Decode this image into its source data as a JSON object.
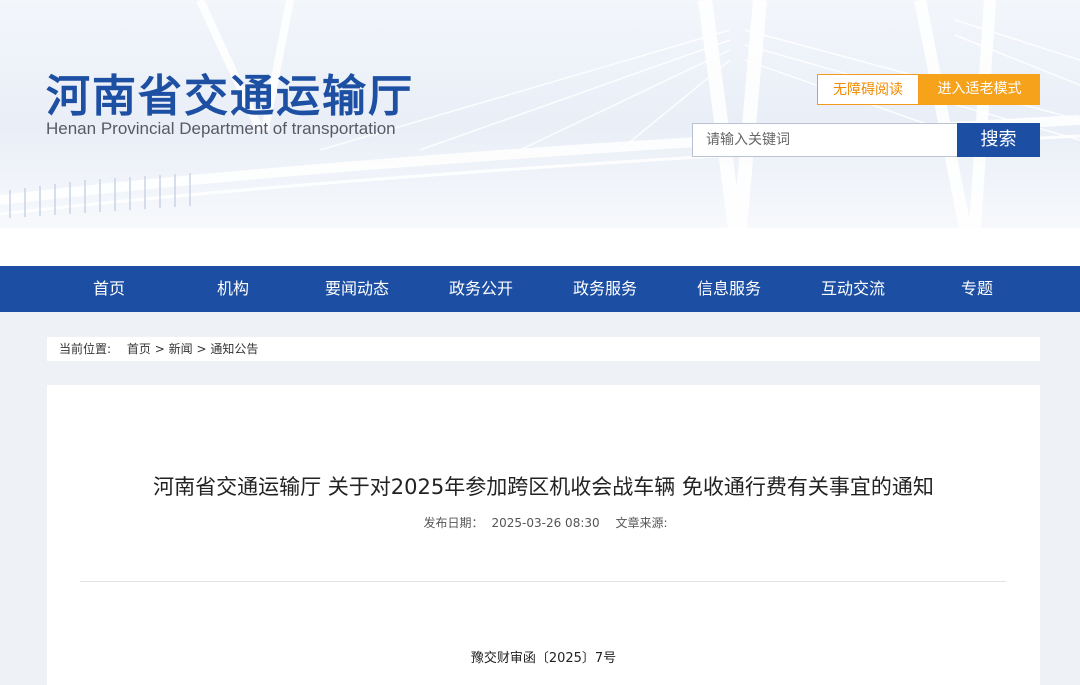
{
  "header": {
    "title_cn": "河南省交通运输厅",
    "title_en": "Henan Provincial Department of transportation",
    "accessibility_label": "无障碍阅读",
    "elder_mode_label": "进入适老模式",
    "search_placeholder": "请输入关键词",
    "search_button": "搜索"
  },
  "nav": {
    "items": [
      "首页",
      "机构",
      "要闻动态",
      "政务公开",
      "政务服务",
      "信息服务",
      "互动交流",
      "专题"
    ]
  },
  "breadcrumb": {
    "label": "当前位置:",
    "items": [
      "首页",
      "新闻",
      "通知公告"
    ],
    "separator": ">"
  },
  "article": {
    "title": "河南省交通运输厅 关于对2025年参加跨区机收会战车辆 免收通行费有关事宜的通知",
    "publish_label": "发布日期：",
    "publish_date": "2025-03-26 08:30",
    "source_label": "文章来源:",
    "doc_number": "豫交财审函〔2025〕7号"
  },
  "colors": {
    "brand_blue": "#1c4fa3",
    "accent_orange": "#f7a21b"
  }
}
